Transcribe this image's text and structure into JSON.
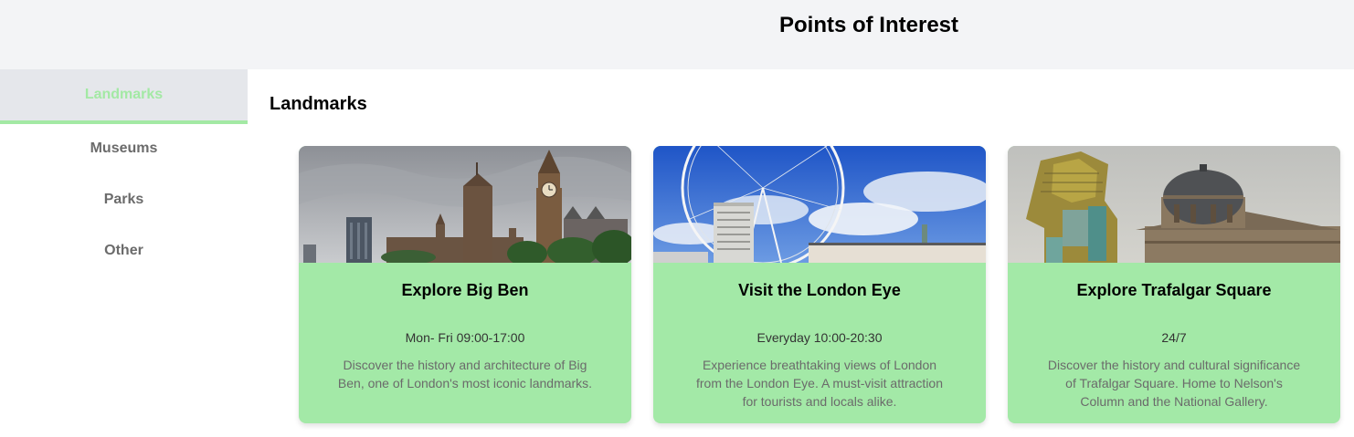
{
  "header": {
    "title": "Points of Interest"
  },
  "sidebar": {
    "items": [
      {
        "label": "Landmarks"
      },
      {
        "label": "Museums"
      },
      {
        "label": "Parks"
      },
      {
        "label": "Other"
      }
    ],
    "active_index": 0
  },
  "main": {
    "section_title": "Landmarks",
    "cards": [
      {
        "title": "Explore Big Ben",
        "hours": "Mon- Fri 09:00-17:00",
        "description": "Discover the history and architecture of Big Ben, one of London's most iconic landmarks.",
        "image": "big-ben-westminster-photo"
      },
      {
        "title": "Visit the London Eye",
        "hours": "Everyday 10:00-20:30",
        "description": "Experience breathtaking views of London from the London Eye. A must-visit attraction for tourists and locals alike.",
        "image": "london-eye-photo"
      },
      {
        "title": "Explore Trafalgar Square",
        "hours": "24/7",
        "description": "Discover the history and cultural significance of Trafalgar Square. Home to Nelson's Column and the National Gallery.",
        "image": "trafalgar-square-lamassu-photo"
      }
    ]
  },
  "colors": {
    "accent": "#a3e9a4",
    "card_background": "#a3e9a7",
    "header_background": "#f3f4f6",
    "sidebar_active_background": "#e5e7eb"
  }
}
